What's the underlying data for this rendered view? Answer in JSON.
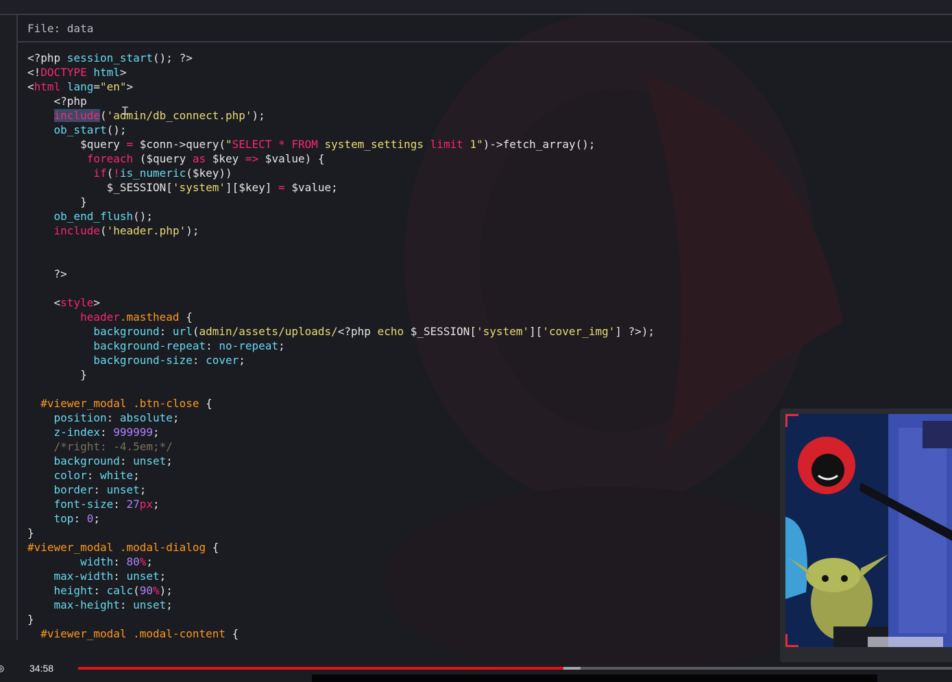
{
  "editor": {
    "file_title": "File: data"
  },
  "player": {
    "timestamp": "34:58",
    "progress_fraction": 0.555,
    "buffered_fraction": 0.575,
    "accent_color": "#e3121a"
  },
  "webcam": {
    "description_icon": "webcam-feed-icon"
  }
}
